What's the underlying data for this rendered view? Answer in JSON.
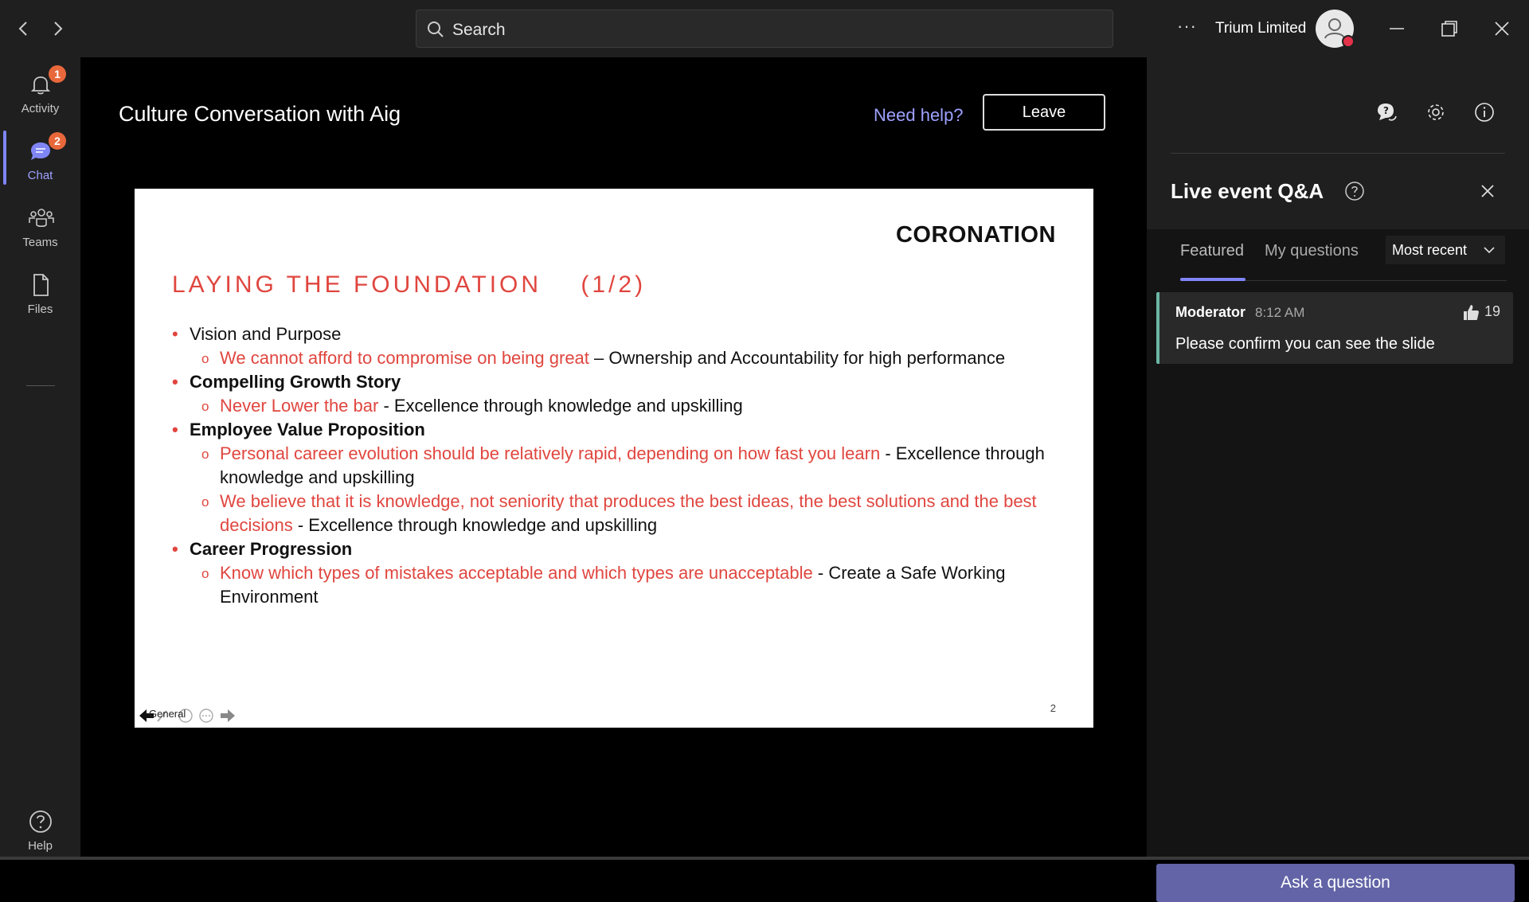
{
  "titlebar": {
    "search_placeholder": "Search",
    "org_name": "Trium Limited",
    "more_icon": "more-horizontal-icon",
    "window_controls": [
      "minimize",
      "restore",
      "close"
    ]
  },
  "rail": {
    "items": [
      {
        "label": "Activity",
        "icon": "bell-icon",
        "badge": "1"
      },
      {
        "label": "Chat",
        "icon": "chat-icon",
        "badge": "2",
        "active": true
      },
      {
        "label": "Teams",
        "icon": "teams-icon"
      },
      {
        "label": "Files",
        "icon": "file-icon"
      }
    ],
    "help_label": "Help"
  },
  "meeting": {
    "title": "Culture Conversation with Aig",
    "need_help": "Need help?",
    "leave_label": "Leave"
  },
  "slide": {
    "logo": "CORONATION",
    "title": "LAYING THE FOUNDATION    (1/2)",
    "page_number": "2",
    "footer_label": "General",
    "sections": [
      {
        "heading": "Vision and Purpose",
        "subs": [
          {
            "red": "We cannot afford to compromise on being great",
            "black": " – Ownership and Accountability for high performance"
          }
        ]
      },
      {
        "heading": "Compelling Growth Story",
        "subs": [
          {
            "red": "Never Lower the bar",
            "black": " - Excellence through knowledge and upskilling"
          }
        ]
      },
      {
        "heading": "Employee Value Proposition",
        "subs": [
          {
            "red": "Personal career evolution should be relatively rapid, depending on how fast you learn",
            "black": " - Excellence through knowledge and upskilling"
          },
          {
            "red": "We believe that it is knowledge, not seniority that produces the best ideas, the best solutions and the best decisions",
            "black": " - Excellence through knowledge and upskilling"
          }
        ]
      },
      {
        "heading": "Career Progression",
        "subs": [
          {
            "red": "Know which types of mistakes acceptable and which types are unacceptable",
            "black": " - Create a Safe Working Environment"
          }
        ]
      }
    ]
  },
  "qa": {
    "title": "Live event Q&A",
    "tabs": [
      "Featured",
      "My questions"
    ],
    "active_tab": "Featured",
    "sort_value": "Most recent",
    "questions": [
      {
        "author": "Moderator",
        "time": "8:12 AM",
        "likes": "19",
        "text": "Please confirm you can see the slide"
      }
    ],
    "ask_label": "Ask a question"
  },
  "colors": {
    "accent": "#7f85f5",
    "button": "#6264a7",
    "badge": "#e8683b",
    "slide_red": "#e0463f",
    "status_busy": "#e3324a"
  }
}
